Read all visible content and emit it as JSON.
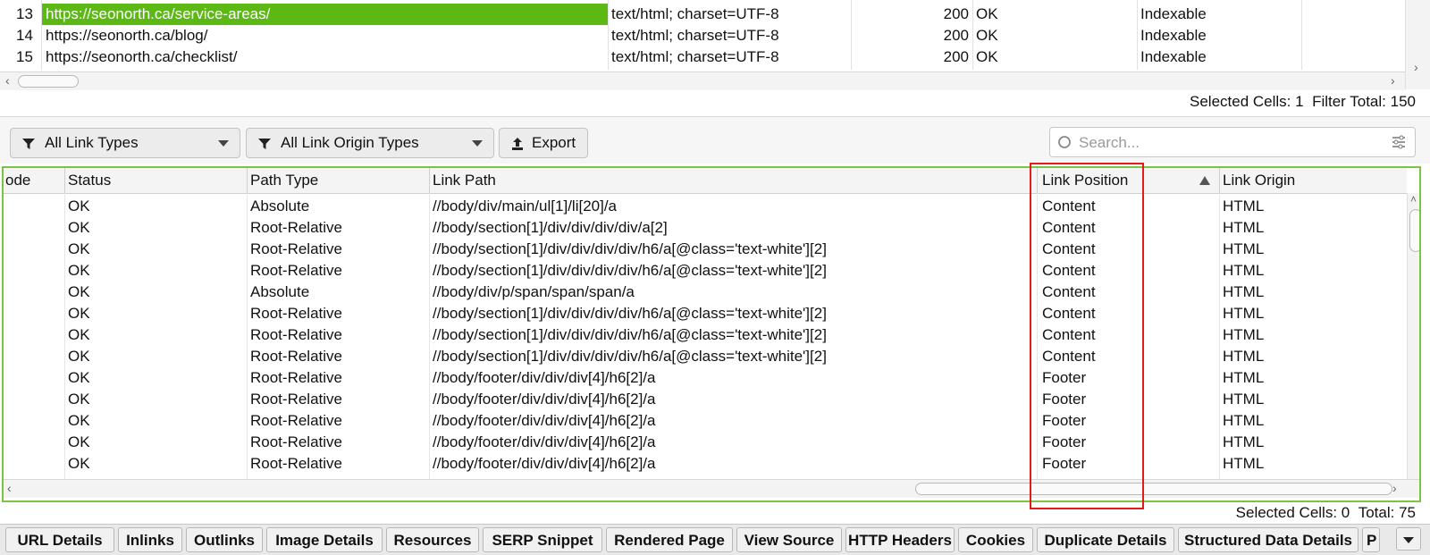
{
  "top_table": {
    "rows": [
      {
        "num": "13",
        "url": "https://seonorth.ca/service-areas/",
        "content_type": "text/html; charset=UTF-8",
        "status_code": "200",
        "status": "OK",
        "indexability": "Indexable",
        "selected": true
      },
      {
        "num": "14",
        "url": "https://seonorth.ca/blog/",
        "content_type": "text/html; charset=UTF-8",
        "status_code": "200",
        "status": "OK",
        "indexability": "Indexable",
        "selected": false
      },
      {
        "num": "15",
        "url": "https://seonorth.ca/checklist/",
        "content_type": "text/html; charset=UTF-8",
        "status_code": "200",
        "status": "OK",
        "indexability": "Indexable",
        "selected": false
      }
    ],
    "status_label": "Selected Cells:",
    "status_selected": "1",
    "status_filter_label": "Filter Total:",
    "status_filter_total": "150"
  },
  "toolbar": {
    "link_types": "All Link Types",
    "link_origin_types": "All Link Origin Types",
    "export_label": "Export",
    "search_placeholder": "Search..."
  },
  "main_table": {
    "headers": {
      "code": "ode",
      "status": "Status",
      "path_type": "Path Type",
      "link_path": "Link Path",
      "link_position": "Link Position",
      "link_origin": "Link Origin"
    },
    "rows": [
      {
        "status": "OK",
        "path_type": "Absolute",
        "link_path": "//body/div/main/ul[1]/li[20]/a",
        "link_position": "Content",
        "link_origin": "HTML"
      },
      {
        "status": "OK",
        "path_type": "Root-Relative",
        "link_path": "//body/section[1]/div/div/div/div/a[2]",
        "link_position": "Content",
        "link_origin": "HTML"
      },
      {
        "status": "OK",
        "path_type": "Root-Relative",
        "link_path": "//body/section[1]/div/div/div/div/h6/a[@class='text-white'][2]",
        "link_position": "Content",
        "link_origin": "HTML"
      },
      {
        "status": "OK",
        "path_type": "Root-Relative",
        "link_path": "//body/section[1]/div/div/div/div/h6/a[@class='text-white'][2]",
        "link_position": "Content",
        "link_origin": "HTML"
      },
      {
        "status": "OK",
        "path_type": "Absolute",
        "link_path": "//body/div/p/span/span/span/a",
        "link_position": "Content",
        "link_origin": "HTML"
      },
      {
        "status": "OK",
        "path_type": "Root-Relative",
        "link_path": "//body/section[1]/div/div/div/div/h6/a[@class='text-white'][2]",
        "link_position": "Content",
        "link_origin": "HTML"
      },
      {
        "status": "OK",
        "path_type": "Root-Relative",
        "link_path": "//body/section[1]/div/div/div/div/h6/a[@class='text-white'][2]",
        "link_position": "Content",
        "link_origin": "HTML"
      },
      {
        "status": "OK",
        "path_type": "Root-Relative",
        "link_path": "//body/section[1]/div/div/div/div/h6/a[@class='text-white'][2]",
        "link_position": "Content",
        "link_origin": "HTML"
      },
      {
        "status": "OK",
        "path_type": "Root-Relative",
        "link_path": "//body/footer/div/div/div[4]/h6[2]/a",
        "link_position": "Footer",
        "link_origin": "HTML"
      },
      {
        "status": "OK",
        "path_type": "Root-Relative",
        "link_path": "//body/footer/div/div/div[4]/h6[2]/a",
        "link_position": "Footer",
        "link_origin": "HTML"
      },
      {
        "status": "OK",
        "path_type": "Root-Relative",
        "link_path": "//body/footer/div/div/div[4]/h6[2]/a",
        "link_position": "Footer",
        "link_origin": "HTML"
      },
      {
        "status": "OK",
        "path_type": "Root-Relative",
        "link_path": "//body/footer/div/div/div[4]/h6[2]/a",
        "link_position": "Footer",
        "link_origin": "HTML"
      },
      {
        "status": "OK",
        "path_type": "Root-Relative",
        "link_path": "//body/footer/div/div/div[4]/h6[2]/a",
        "link_position": "Footer",
        "link_origin": "HTML"
      }
    ],
    "sort_indicator": "ascending",
    "status_label": "Selected Cells:",
    "status_selected": "0",
    "status_total_label": "Total:",
    "status_total": "75"
  },
  "tabs": [
    "URL Details",
    "Inlinks",
    "Outlinks",
    "Image Details",
    "Resources",
    "SERP Snippet",
    "Rendered Page",
    "View Source",
    "HTTP Headers",
    "Cookies",
    "Duplicate Details",
    "Structured Data Details",
    "P"
  ],
  "colors": {
    "selected_row": "#5cb812",
    "table_border": "#7cc243",
    "highlight_box": "#e11b1b"
  }
}
